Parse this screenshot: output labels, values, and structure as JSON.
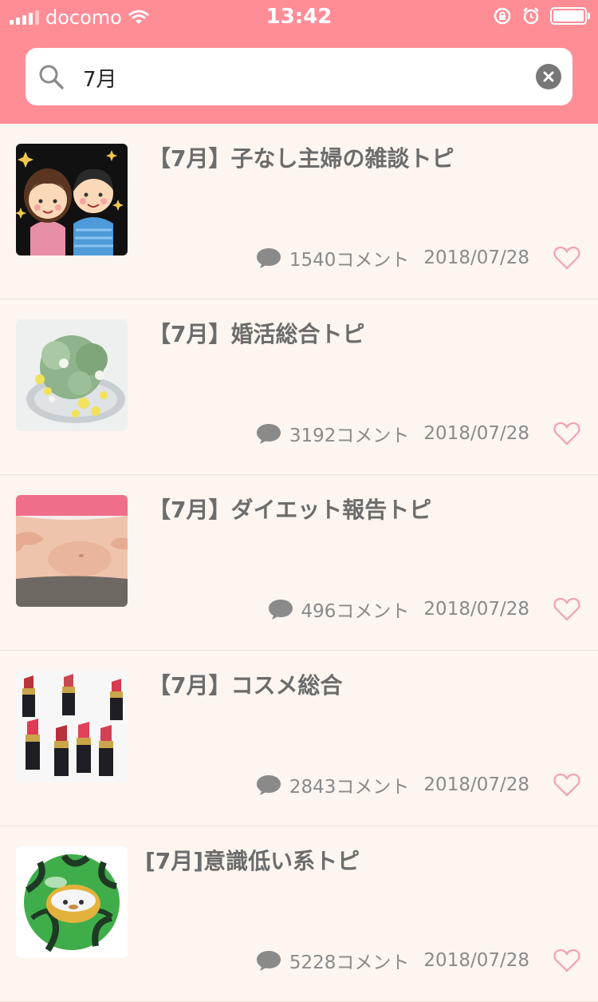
{
  "status": {
    "carrier": "docomo",
    "time": "13:42"
  },
  "search": {
    "value": "7月"
  },
  "colors": {
    "header": "#ff8d96",
    "background": "#fdf5ef",
    "heart": "#f2a0b2"
  },
  "topics": [
    {
      "title": "【7月】子なし主婦の雑談トピ",
      "comments": "1540コメント",
      "date": "2018/07/28"
    },
    {
      "title": "【7月】婚活総合トピ",
      "comments": "3192コメント",
      "date": "2018/07/28"
    },
    {
      "title": "【7月】ダイエット報告トピ",
      "comments": "496コメント",
      "date": "2018/07/28"
    },
    {
      "title": "【7月】コスメ総合",
      "comments": "2843コメント",
      "date": "2018/07/28"
    },
    {
      "title": "[7月]意識低い系トピ",
      "comments": "5228コメント",
      "date": "2018/07/28"
    }
  ]
}
